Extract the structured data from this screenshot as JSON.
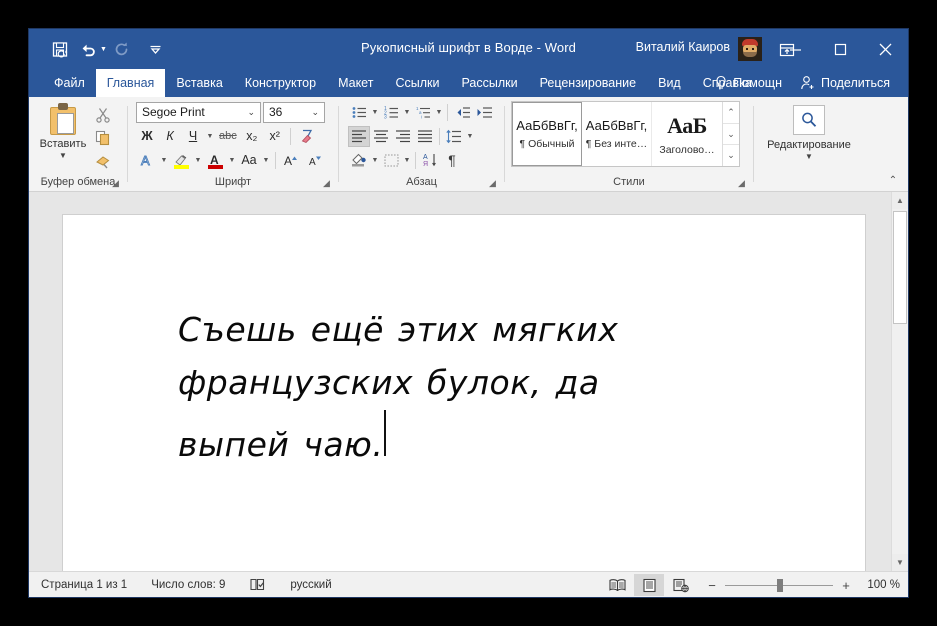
{
  "window": {
    "title": "Рукописный шрифт в Ворде  -  Word",
    "account_name": "Виталий Каиров",
    "accent_color": "#2b579a",
    "controls": {
      "minimize": "—",
      "maximize": "▢",
      "close": "✕"
    }
  },
  "quick_access": {
    "items": [
      {
        "name": "save-icon",
        "label": "Сохранить"
      },
      {
        "name": "undo-icon",
        "label": "Отменить"
      },
      {
        "name": "redo-icon",
        "label": "Вернуть"
      },
      {
        "name": "customize-qat-icon",
        "label": "Настройка панели быстрого доступа"
      }
    ]
  },
  "tabs": {
    "items": [
      {
        "label": "Файл",
        "active": false
      },
      {
        "label": "Главная",
        "active": true
      },
      {
        "label": "Вставка",
        "active": false
      },
      {
        "label": "Конструктор",
        "active": false
      },
      {
        "label": "Макет",
        "active": false
      },
      {
        "label": "Ссылки",
        "active": false
      },
      {
        "label": "Рассылки",
        "active": false
      },
      {
        "label": "Рецензирование",
        "active": false
      },
      {
        "label": "Вид",
        "active": false
      },
      {
        "label": "Справка",
        "active": false
      }
    ],
    "tell_me": "Помощн",
    "share": "Поделиться"
  },
  "ribbon": {
    "clipboard": {
      "group_label": "Буфер обмена",
      "paste_label": "Вставить",
      "cut_label": "Вырезать",
      "copy_label": "Копировать",
      "format_painter_label": "Формат по образцу"
    },
    "font": {
      "group_label": "Шрифт",
      "font_name": "Segoe Print",
      "font_size": "36",
      "bold": "Ж",
      "italic": "К",
      "underline": "Ч",
      "strikethrough": "abc",
      "subscript": "x₂",
      "superscript": "x²",
      "clear_formatting": "Удалить всё форматирование",
      "text_effects": "A",
      "highlight_color": "#ffff00",
      "font_color": "#cc0000",
      "change_case": "Aa",
      "grow_font": "A",
      "shrink_font": "A"
    },
    "paragraph": {
      "group_label": "Абзац",
      "bullets": "Маркеры",
      "numbering": "Нумерация",
      "multilevel": "Многоуровневый список",
      "decrease_indent": "Уменьшить отступ",
      "increase_indent": "Увеличить отступ",
      "align_left": "По левому краю",
      "align_center": "По центру",
      "align_right": "По правому краю",
      "justify": "По ширине",
      "line_spacing": "Интервал",
      "shading": "Заливка",
      "borders": "Границы",
      "sort": "Сортировка",
      "show_marks": "¶"
    },
    "styles": {
      "group_label": "Стили",
      "items": [
        {
          "preview": "АаБбВвГг,",
          "name": "¶ Обычный",
          "selected": true,
          "kind": "normal"
        },
        {
          "preview": "АаБбВвГг,",
          "name": "¶ Без инте…",
          "selected": false,
          "kind": "normal"
        },
        {
          "preview": "АаБ",
          "name": "Заголово…",
          "selected": false,
          "kind": "heading"
        }
      ]
    },
    "editing": {
      "group_label": "Редактирование",
      "button_label": "Редактирование"
    },
    "collapse_label": "Свернуть ленту"
  },
  "document": {
    "lines": [
      "Съешь ещё этих мягких",
      "французских булок, да",
      "выпей чаю."
    ]
  },
  "status_bar": {
    "page": "Страница 1 из 1",
    "words": "Число слов: 9",
    "proofing": "Проверка правописания",
    "language": "русский",
    "views": [
      {
        "name": "read-mode-view",
        "label": "Режим чтения",
        "active": false
      },
      {
        "name": "print-layout-view",
        "label": "Разметка страницы",
        "active": true
      },
      {
        "name": "web-layout-view",
        "label": "Веб-документ",
        "active": false
      }
    ],
    "zoom_out": "−",
    "zoom_in": "+",
    "zoom_level": "100 %"
  }
}
